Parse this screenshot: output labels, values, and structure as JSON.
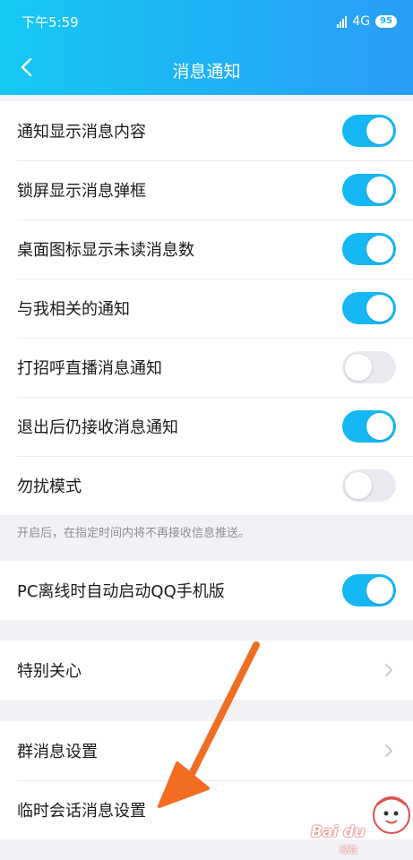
{
  "status_bar": {
    "time": "下午5:59",
    "network": "4G",
    "battery": "95",
    "signal_icon": "signal-icon"
  },
  "nav": {
    "title": "消息通知",
    "back_icon": "back-arrow-icon"
  },
  "settings": {
    "group1": [
      {
        "label": "通知显示消息内容",
        "on": true
      },
      {
        "label": "锁屏显示消息弹框",
        "on": true
      },
      {
        "label": "桌面图标显示未读消息数",
        "on": true
      },
      {
        "label": "与我相关的通知",
        "on": true
      },
      {
        "label": "打招呼直播消息通知",
        "on": false
      },
      {
        "label": "退出后仍接收消息通知",
        "on": true
      },
      {
        "label": "勿扰模式",
        "on": false
      }
    ],
    "dnd_hint": "开启后，在指定时间内将不再接收信息推送。",
    "pc_offline": {
      "label": "PC离线时自动启动QQ手机版",
      "on": true
    },
    "special_care": "特别关心",
    "group_settings": "群消息设置",
    "temp_chat_settings": "临时会话消息设置"
  },
  "watermark": {
    "text": "Bai du",
    "sub": "经验"
  },
  "colors": {
    "accent": "#15b7f5",
    "toggle_off": "#e9eaef",
    "arrow": "#f26c22"
  }
}
